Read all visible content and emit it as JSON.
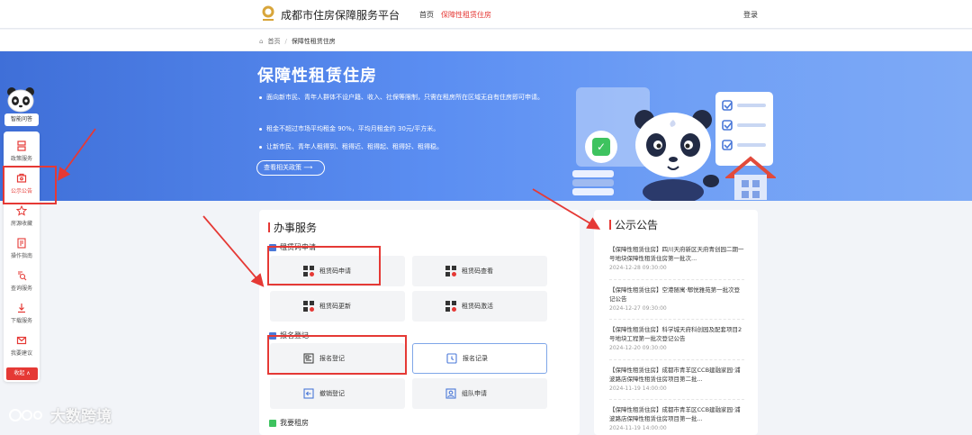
{
  "header": {
    "site_title": "成都市住房保障服务平台",
    "nav": [
      {
        "label": "首页"
      },
      {
        "label": "保障性租赁住房"
      }
    ],
    "login_label": "登录"
  },
  "breadcrumb": {
    "home": "首页",
    "separator": "/",
    "current": "保障性租赁住房"
  },
  "banner": {
    "title": "保障性租赁住房",
    "bullets": [
      "面向新市民、青年人群体不设户籍、收入、社保等限制，只需在租房所在区域无自有住房即可申请。",
      "租金不超过市场平均租金 90%，平均月租金约 30元/平方米。",
      "让新市民、青年人租得到、租得近、租得起、租得好、租得稳。"
    ],
    "policy_button": "查看相关政策 ⟶"
  },
  "sidebar": {
    "assistant_label": "智能问答",
    "items": [
      {
        "label": "政策服务",
        "icon": "policy-icon"
      },
      {
        "label": "公示公告",
        "icon": "announcement-icon"
      },
      {
        "label": "房源收藏",
        "icon": "star-icon"
      },
      {
        "label": "操作指南",
        "icon": "guide-icon"
      },
      {
        "label": "查询服务",
        "icon": "search-icon"
      },
      {
        "label": "下载服务",
        "icon": "download-icon"
      },
      {
        "label": "我要建议",
        "icon": "mail-icon"
      }
    ],
    "collapse_label": "收起 ∧"
  },
  "services": {
    "title": "办事服务",
    "groups": [
      {
        "title": "租赁码申请"
      },
      {
        "title": "报名登记"
      },
      {
        "title": "我要租房"
      }
    ],
    "tiles": [
      {
        "label": "租赁码申请",
        "icon": "qrcode-icon"
      },
      {
        "label": "租赁码查看",
        "icon": "qrcode-icon"
      },
      {
        "label": "租赁码更新",
        "icon": "qrcode-icon"
      },
      {
        "label": "租赁码激活",
        "icon": "qrcode-icon"
      },
      {
        "label": "报名登记",
        "icon": "form-icon"
      },
      {
        "label": "报名记录",
        "icon": "clock-icon"
      },
      {
        "label": "撤销登记",
        "icon": "undo-icon"
      },
      {
        "label": "组队申请",
        "icon": "team-icon"
      }
    ]
  },
  "announcements": {
    "title": "公示公告",
    "items": [
      {
        "text": "【保障性租赁住房】四川天府新区天府青创园二期一号地块保障性租赁住房第一批次...",
        "date": "2024-12-28 09:30:00"
      },
      {
        "text": "【保障性租赁住房】空港随寓·郫悦雅苑第一批次登记公告",
        "date": "2024-12-27 09:30:00"
      },
      {
        "text": "【保障性租赁住房】科学城天府科创园及配套项目2号地块工程第一批次登记公告",
        "date": "2024-12-20 09:30:00"
      },
      {
        "text": "【保障性租赁住房】成都市青羊区CCB建融家园·浦波路店保障性租赁住房项目第二批...",
        "date": "2024-11-19 14:00:00"
      },
      {
        "text": "【保障性租赁住房】成都市青羊区CCB建融家园·浦波路店保障性租赁住房项目第一批...",
        "date": "2024-11-19 14:00:00"
      }
    ]
  },
  "watermark": {
    "text": "大数跨境"
  },
  "colors": {
    "accent": "#e53935",
    "banner": "#5b8ef2",
    "highlight_border": "#7fa6e8"
  }
}
